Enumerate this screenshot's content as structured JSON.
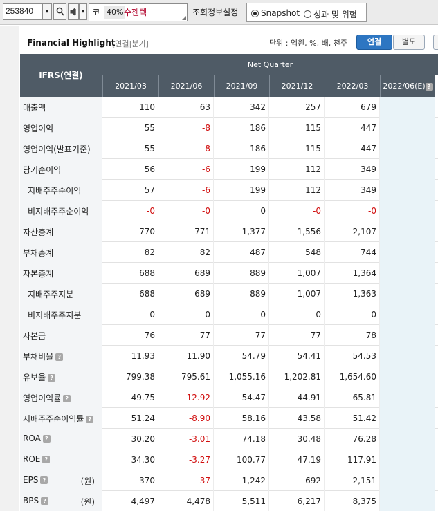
{
  "toolbar": {
    "code": "253840",
    "dropdown_glyph": "▾",
    "search_glyph": "🔍",
    "speaker_glyph": "🔊",
    "market_code": "코",
    "market_pct": "40%",
    "company_name": "수젠텍",
    "settings_label": "조회정보설정",
    "radio_snapshot": "Snapshot",
    "radio_risk": "성과 및 위험",
    "selected_radio": "Snapshot"
  },
  "highlight": {
    "title": "Financial Highlight",
    "subtitle": "[연결|분기]",
    "unit_text": "단위 : 억원, %, 배, 천주",
    "toggle_on": "연결",
    "toggle_off": "별도"
  },
  "table": {
    "corner_header": "IFRS(연결)",
    "group_header": "Net Quarter",
    "periods": [
      "2021/03",
      "2021/06",
      "2021/09",
      "2021/12",
      "2022/03",
      "2022/06(E)"
    ],
    "rows": [
      {
        "label": "매출액",
        "indent": false,
        "help": false,
        "unit": "",
        "values": [
          "110",
          "63",
          "342",
          "257",
          "679",
          ""
        ]
      },
      {
        "label": "영업이익",
        "indent": false,
        "help": false,
        "unit": "",
        "values": [
          "55",
          "-8",
          "186",
          "115",
          "447",
          ""
        ]
      },
      {
        "label": "영업이익(발표기준)",
        "indent": false,
        "help": false,
        "unit": "",
        "values": [
          "55",
          "-8",
          "186",
          "115",
          "447",
          ""
        ]
      },
      {
        "label": "당기순이익",
        "indent": false,
        "help": false,
        "unit": "",
        "values": [
          "56",
          "-6",
          "199",
          "112",
          "349",
          ""
        ]
      },
      {
        "label": "지배주주순이익",
        "indent": true,
        "help": false,
        "unit": "",
        "values": [
          "57",
          "-6",
          "199",
          "112",
          "349",
          ""
        ]
      },
      {
        "label": "비지배주주순이익",
        "indent": true,
        "help": false,
        "unit": "",
        "values": [
          "-0",
          "-0",
          "0",
          "-0",
          "-0",
          ""
        ]
      },
      {
        "label": "자산총계",
        "indent": false,
        "help": false,
        "unit": "",
        "values": [
          "770",
          "771",
          "1,377",
          "1,556",
          "2,107",
          ""
        ]
      },
      {
        "label": "부채총계",
        "indent": false,
        "help": false,
        "unit": "",
        "values": [
          "82",
          "82",
          "487",
          "548",
          "744",
          ""
        ]
      },
      {
        "label": "자본총계",
        "indent": false,
        "help": false,
        "unit": "",
        "values": [
          "688",
          "689",
          "889",
          "1,007",
          "1,364",
          ""
        ]
      },
      {
        "label": "지배주주지분",
        "indent": true,
        "help": false,
        "unit": "",
        "values": [
          "688",
          "689",
          "889",
          "1,007",
          "1,363",
          ""
        ]
      },
      {
        "label": "비지배주주지분",
        "indent": true,
        "help": false,
        "unit": "",
        "values": [
          "0",
          "0",
          "0",
          "0",
          "0",
          ""
        ]
      },
      {
        "label": "자본금",
        "indent": false,
        "help": false,
        "unit": "",
        "values": [
          "76",
          "77",
          "77",
          "77",
          "78",
          ""
        ]
      },
      {
        "label": "부채비율",
        "indent": false,
        "help": true,
        "unit": "",
        "values": [
          "11.93",
          "11.90",
          "54.79",
          "54.41",
          "54.53",
          ""
        ]
      },
      {
        "label": "유보율",
        "indent": false,
        "help": true,
        "unit": "",
        "values": [
          "799.38",
          "795.61",
          "1,055.16",
          "1,202.81",
          "1,654.60",
          ""
        ]
      },
      {
        "label": "영업이익률",
        "indent": false,
        "help": true,
        "unit": "",
        "values": [
          "49.75",
          "-12.92",
          "54.47",
          "44.91",
          "65.81",
          ""
        ]
      },
      {
        "label": "지배주주순이익률",
        "indent": false,
        "help": true,
        "unit": "",
        "values": [
          "51.24",
          "-8.90",
          "58.16",
          "43.58",
          "51.42",
          ""
        ]
      },
      {
        "label": "ROA",
        "indent": false,
        "help": true,
        "unit": "",
        "values": [
          "30.20",
          "-3.01",
          "74.18",
          "30.48",
          "76.28",
          ""
        ]
      },
      {
        "label": "ROE",
        "indent": false,
        "help": true,
        "unit": "",
        "values": [
          "34.30",
          "-3.27",
          "100.77",
          "47.19",
          "117.91",
          ""
        ]
      },
      {
        "label": "EPS",
        "indent": false,
        "help": true,
        "unit": "(원)",
        "values": [
          "370",
          "-37",
          "1,242",
          "692",
          "2,151",
          ""
        ]
      },
      {
        "label": "BPS",
        "indent": false,
        "help": true,
        "unit": "(원)",
        "values": [
          "4,497",
          "4,478",
          "5,511",
          "6,217",
          "8,375",
          ""
        ]
      }
    ]
  },
  "colors": {
    "header_bg": "#4f5b66",
    "negative": "#d10e0e",
    "estimate_bg": "#e9f3f8",
    "toggle_active": "#2d76c2"
  }
}
